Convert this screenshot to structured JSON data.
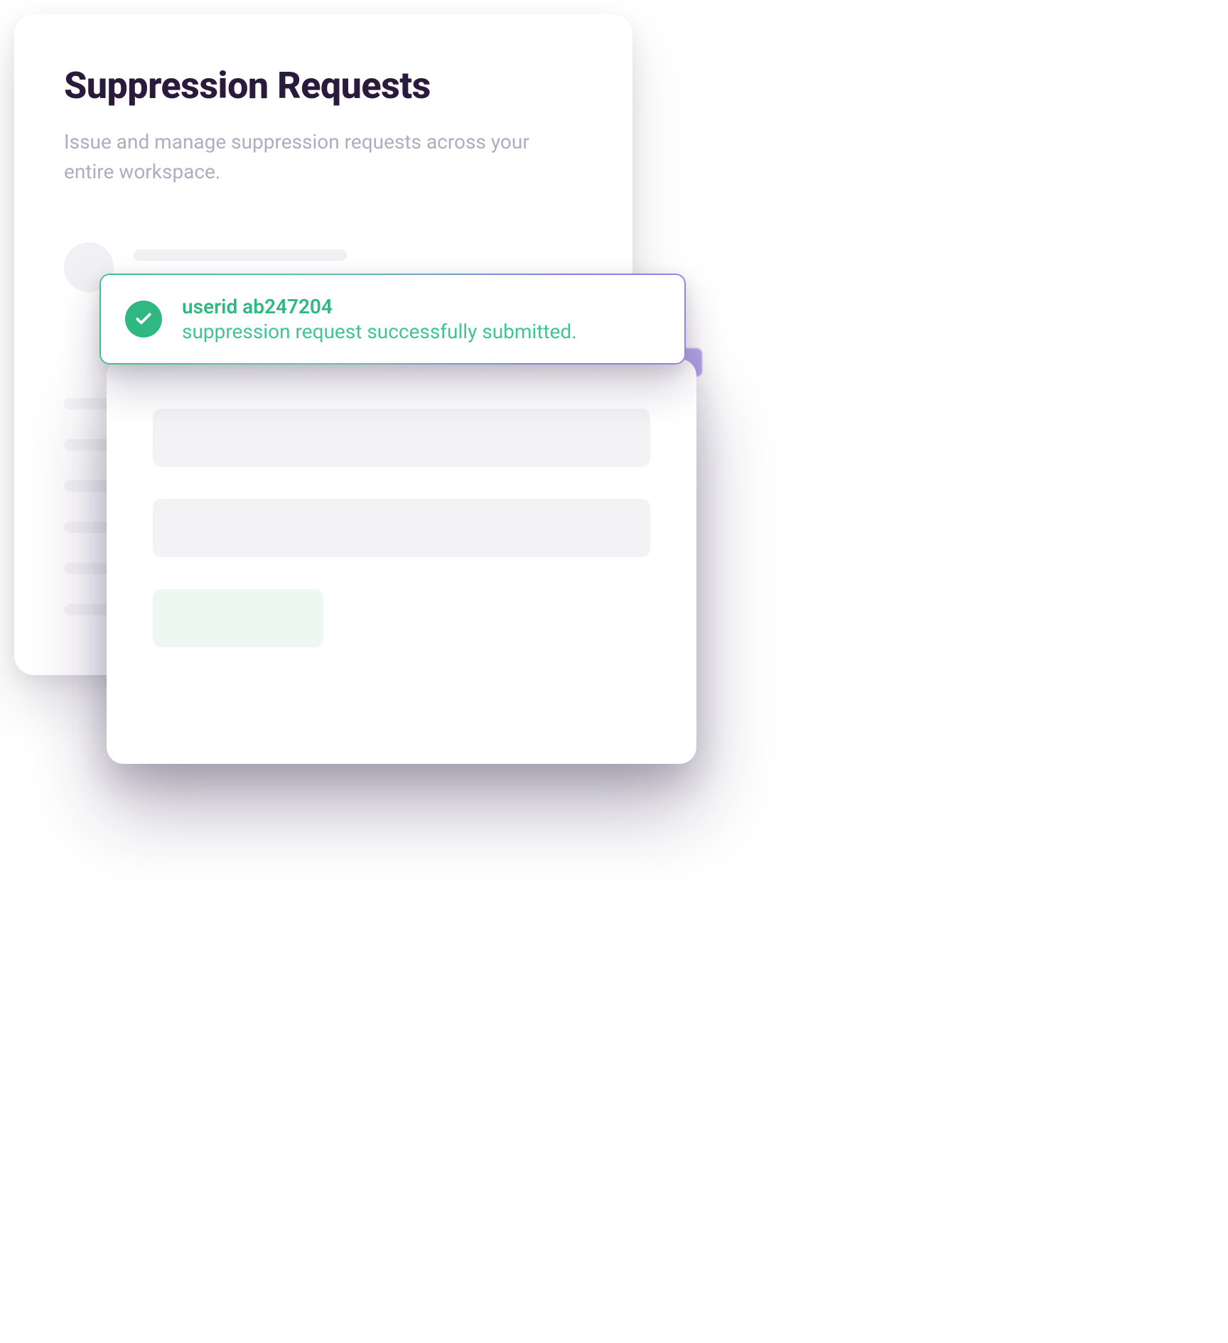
{
  "header": {
    "title": "Suppression Requests",
    "subtitle": "Issue and manage suppression requests across your entire workspace."
  },
  "toast": {
    "title": "userid ab247204",
    "message": "suppression request successfully submitted."
  },
  "colors": {
    "success": "#2fb880",
    "heading": "#2a1b3d",
    "muted": "#b3aac2"
  }
}
